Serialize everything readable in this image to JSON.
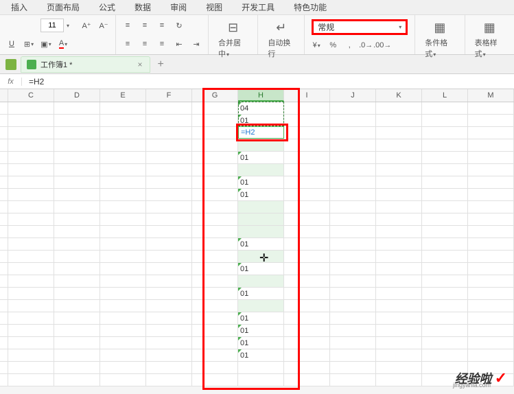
{
  "menu": {
    "items": [
      "插入",
      "页面布局",
      "公式",
      "数据",
      "审阅",
      "视图",
      "开发工具",
      "特色功能"
    ]
  },
  "ribbon": {
    "font_size": "11",
    "merge_label": "合并居中",
    "wrap_label": "自动换行",
    "format_select": "常规",
    "cond_format": "条件格式",
    "table_style": "表格样式"
  },
  "tabs": {
    "doc_name": "工作簿1 *"
  },
  "formula_bar": {
    "fx": "fx",
    "value": "=H2"
  },
  "columns": [
    "C",
    "D",
    "E",
    "F",
    "G",
    "H",
    "I",
    "J",
    "K",
    "L",
    "M"
  ],
  "cells": {
    "h_values": [
      "04",
      "01",
      "",
      "",
      "01",
      "",
      "01",
      "01",
      "",
      "",
      "",
      "01",
      "",
      "01",
      "",
      "01",
      "",
      "01",
      "01",
      "01",
      "01"
    ],
    "green_rows": [
      2,
      3,
      5,
      8,
      9,
      10,
      12,
      14,
      16
    ],
    "tick_rows": [
      0,
      1,
      4,
      6,
      7,
      11,
      13,
      15,
      17,
      18,
      19,
      20
    ]
  },
  "edit_cell": {
    "value": "=H2"
  },
  "cursor_glyph": "✛",
  "watermark": {
    "text": "经验啦",
    "check": "✓",
    "sub": "jingyanla.com"
  }
}
